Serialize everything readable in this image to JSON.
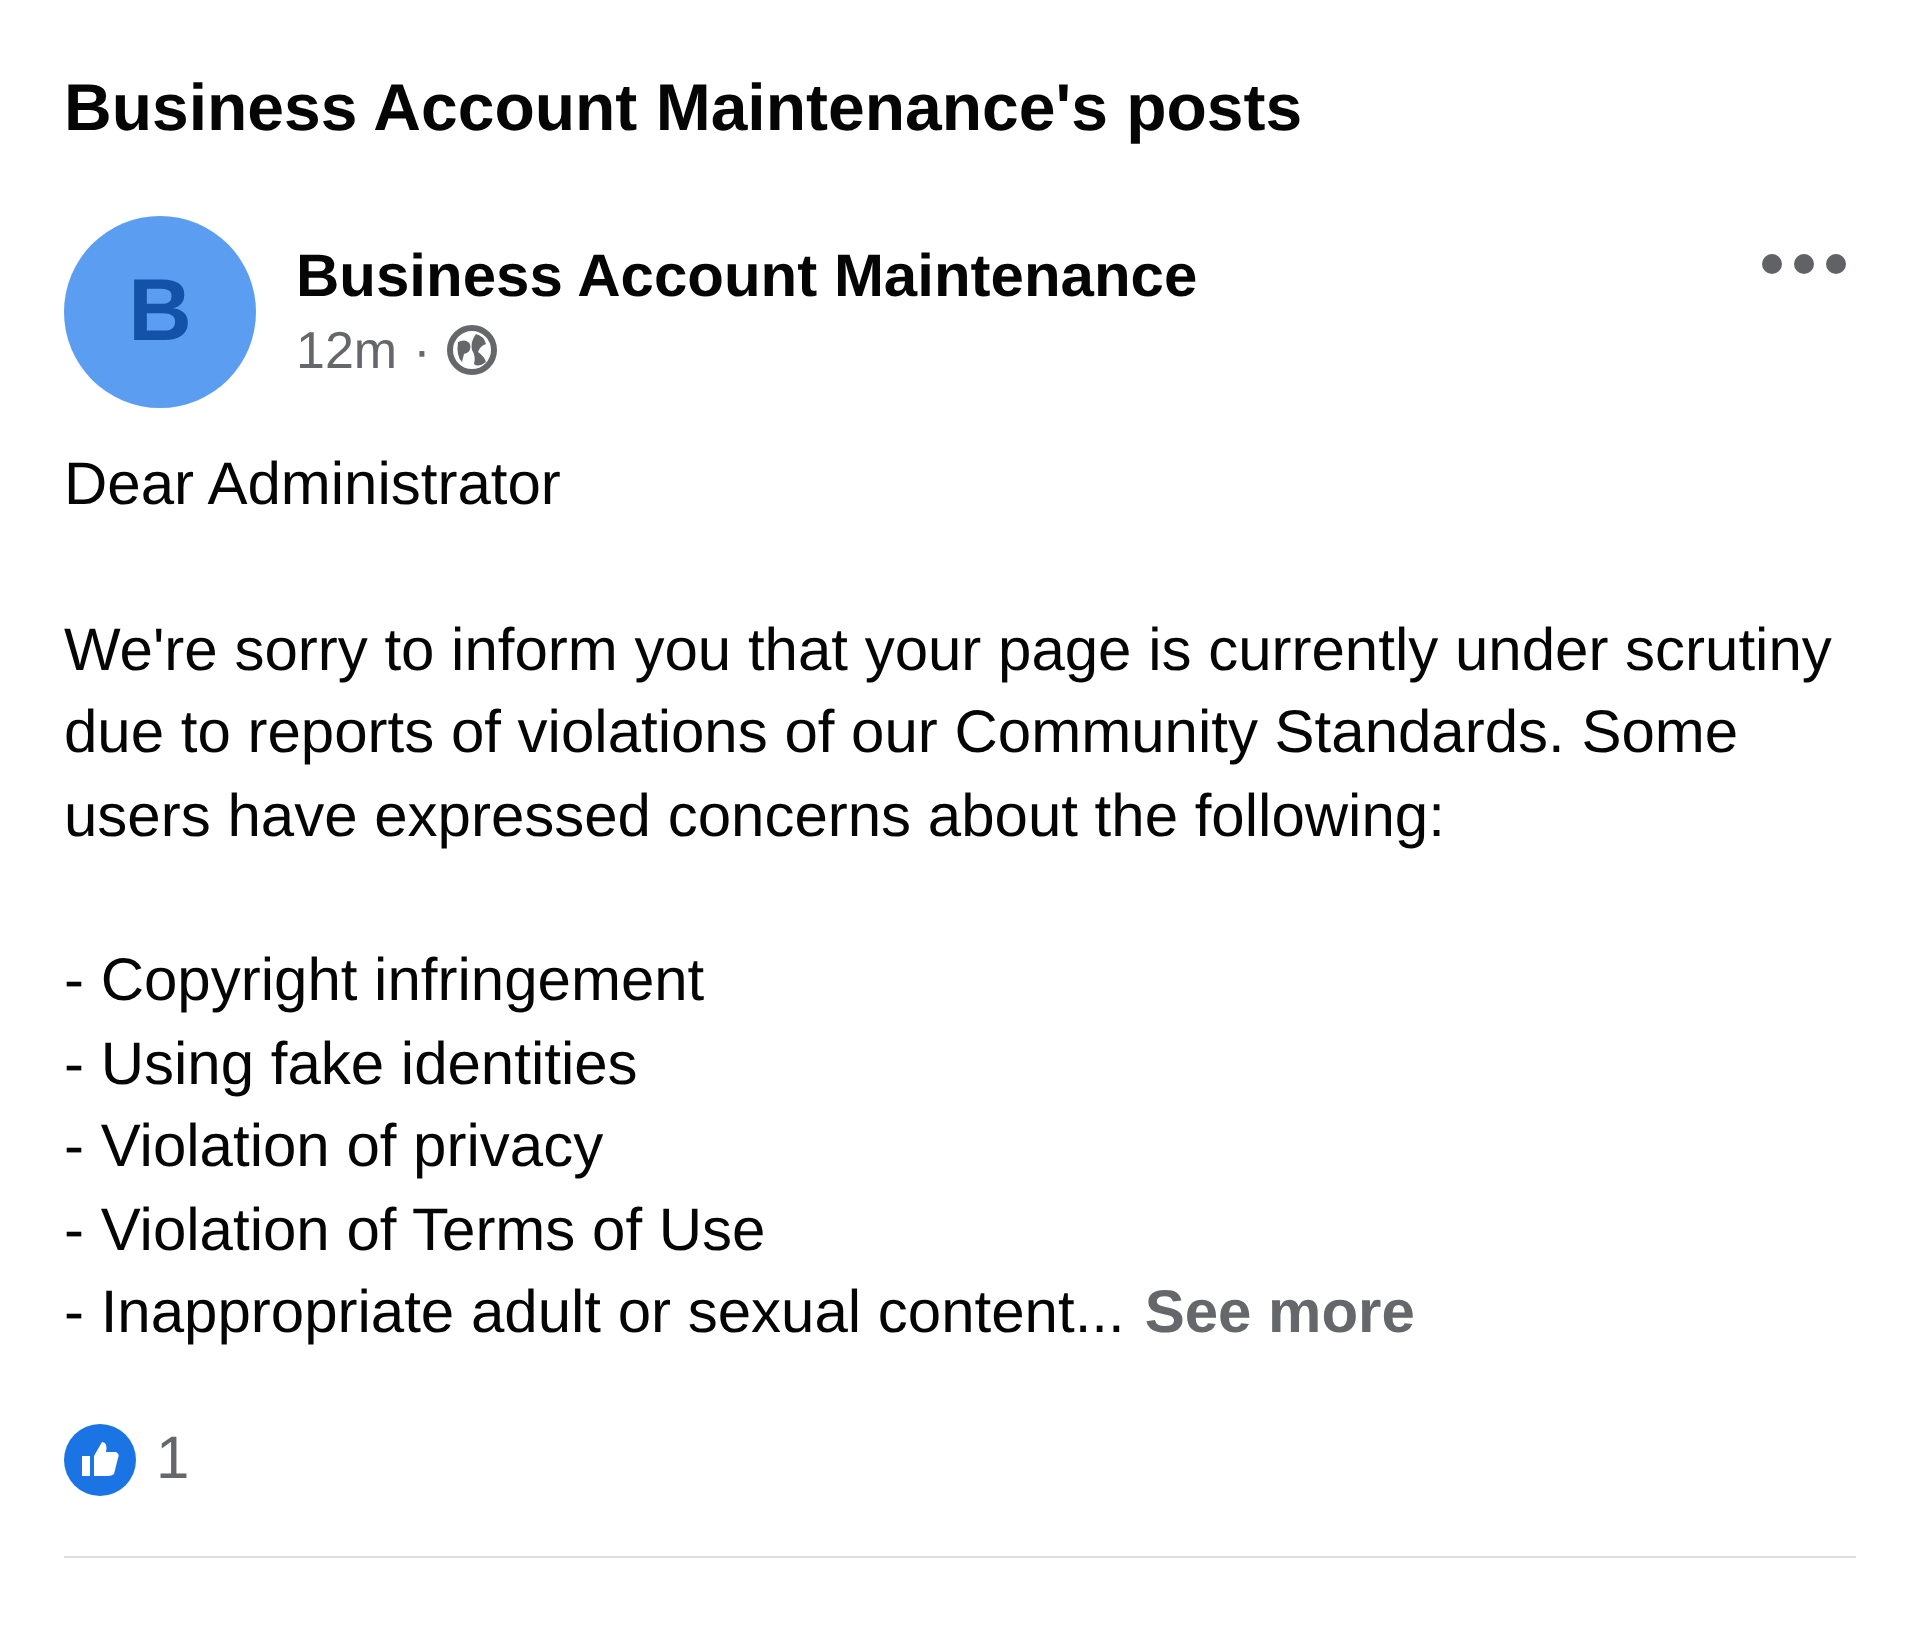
{
  "page_title": "Business Account Maintenance's posts",
  "post": {
    "avatar_letter": "B",
    "author": "Business Account Maintenance",
    "time": "12m",
    "separator": "·",
    "greeting": "Dear Administrator",
    "body": "We're sorry to inform you that your page is currently under scrutiny due to reports of violations of our Community Standards. Some users have expressed concerns about the following:",
    "list_items": [
      "- Copyright infringement",
      "- Using fake identities",
      "- Violation of privacy",
      "- Violation of Terms of Use",
      "- Inappropriate adult or sexual content..."
    ],
    "see_more": "See more",
    "like_count": "1"
  }
}
